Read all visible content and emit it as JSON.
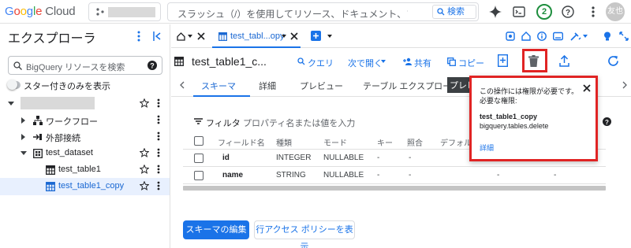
{
  "topbar": {
    "logo": "Google Cloud",
    "search_placeholder": "スラッシュ（/）を使用してリソース、ドキュメント、プロダクト...",
    "search_button": "検索",
    "notification_count": "2",
    "avatar": "友也"
  },
  "explorer": {
    "title": "エクスプローラ",
    "search_placeholder": "BigQuery リソースを検索",
    "starred_only_label": "スター付きのみを表示",
    "tree": [
      {
        "label": ""
      },
      {
        "label": "ワークフロー"
      },
      {
        "label": "外部接続"
      },
      {
        "label": "test_dataset"
      },
      {
        "label": "test_table1"
      },
      {
        "label": "test_table1_copy"
      }
    ]
  },
  "tabs": {
    "active_tab_label": "test_tabl...opy"
  },
  "toolbar": {
    "title": "test_table1_c...",
    "query": "クエリ",
    "open_next": "次で開く",
    "share": "共有",
    "copy": "コピー"
  },
  "subtabs": [
    "スキーマ",
    "詳細",
    "プレビュー",
    "テーブル エクスプローラ",
    "プレビ"
  ],
  "schema": {
    "filter_label": "フィルタ",
    "filter_placeholder": "プロパティ名または値を入力",
    "columns": [
      "フィールド名",
      "種類",
      "モード",
      "キー",
      "照合",
      "デフォルト"
    ],
    "rows": [
      {
        "name": "id",
        "type": "INTEGER",
        "mode": "NULLABLE",
        "key": "-",
        "collation": "-",
        "extra": "-"
      },
      {
        "name": "name",
        "type": "STRING",
        "mode": "NULLABLE",
        "key": "-",
        "collation": "-",
        "extra": "-"
      }
    ],
    "edit_schema_button": "スキーマの編集",
    "row_access_button": "行アクセス ポリシーを表示"
  },
  "popup": {
    "line1": "この操作には権限が必要です。",
    "line2": "必要な権限:",
    "resource": "test_table1_copy",
    "permission": "bigquery.tables.delete",
    "details_link": "詳細"
  },
  "colors": {
    "accent": "#1a73e8",
    "highlight": "#e02424",
    "selected_bg": "#e8f0fe"
  }
}
